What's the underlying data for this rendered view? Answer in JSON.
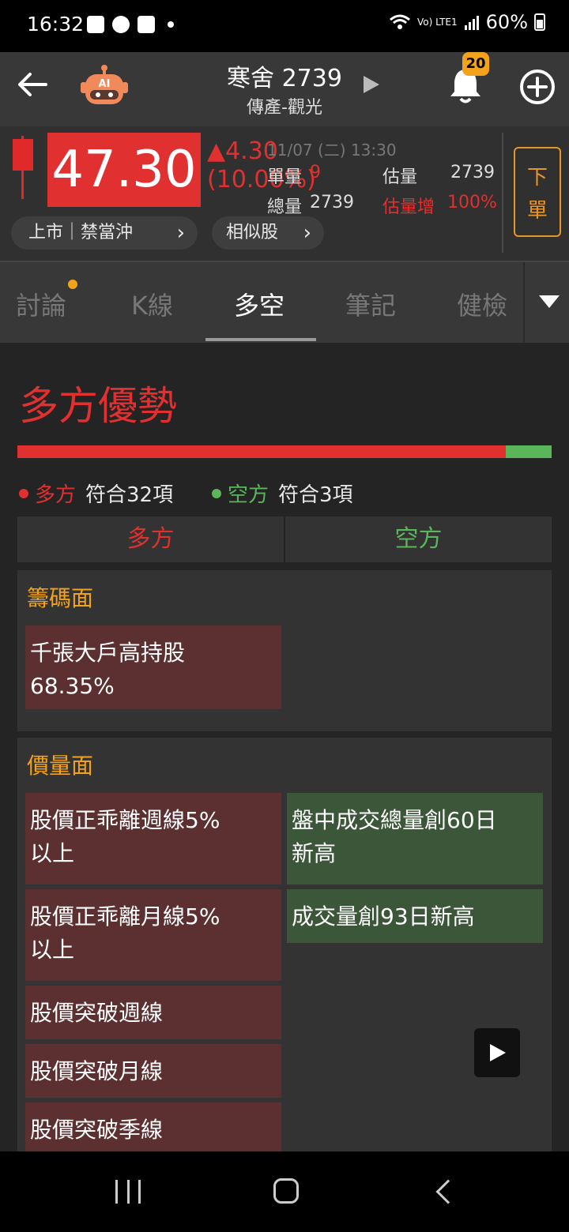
{
  "status_bar": {
    "time": "16:32",
    "network": "Vo) LTE1",
    "battery": "60%"
  },
  "header": {
    "title": "寒舍 2739",
    "subtitle": "傳產-觀光",
    "notification_count": "20"
  },
  "quote": {
    "price": "47.30",
    "change": "▲4.30",
    "change_pct": "(10.00%)",
    "datetime": "11/07 (二) 13:30",
    "single_volume_label": "單量",
    "single_volume": "9",
    "total_volume_label": "總量",
    "total_volume": "2739",
    "est_volume_label": "估量",
    "est_volume": "2739",
    "est_increase_label": "估量增",
    "est_increase": "100%",
    "market_pill": "上市｜禁當沖",
    "similar_pill": "相似股",
    "order_button": "下\n單"
  },
  "tabs": [
    "討論",
    "K線",
    "多空",
    "筆記",
    "健檢"
  ],
  "active_tab": "多空",
  "main": {
    "title": "多方優勢",
    "bull_ratio": 0.914,
    "bull_label": "多方",
    "bull_count": "符合32項",
    "bear_label": "空方",
    "bear_count": "符合3項",
    "col_bull": "多方",
    "col_bear": "空方",
    "sections": [
      {
        "title": "籌碼面",
        "bull": [
          "千張大戶高持股\n68.35%"
        ],
        "bear": []
      },
      {
        "title": "價量面",
        "bull": [
          "股價正乖離週線5%\n以上",
          "股價正乖離月線5%\n以上",
          "股價突破週線",
          "股價突破月線",
          "股價突破季線"
        ],
        "bear": [
          "盤中成交總量創60日\n新高",
          "成交量創93日新高"
        ]
      }
    ]
  },
  "colors": {
    "bull": "#e03030",
    "bear": "#5bb55b",
    "accent": "#f2a31b"
  }
}
